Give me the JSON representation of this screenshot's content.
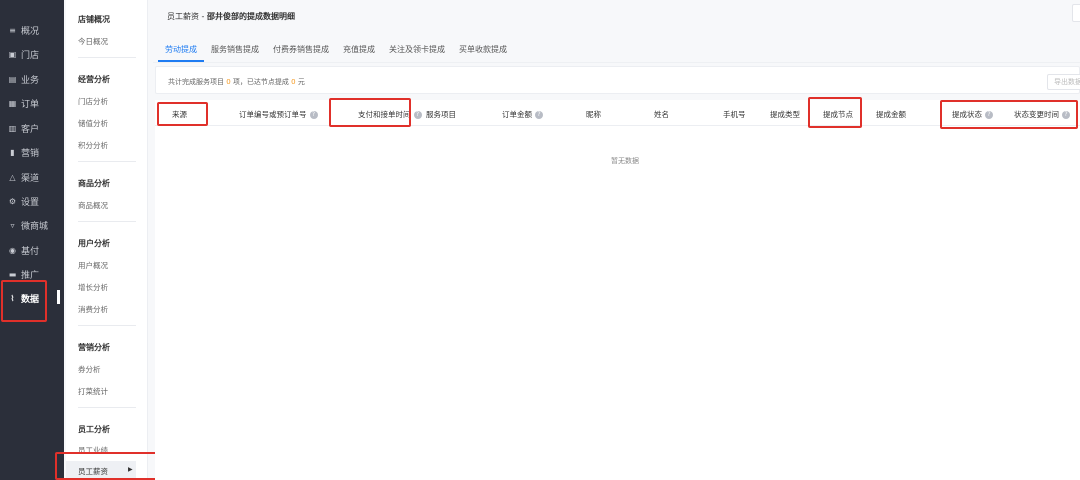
{
  "nav": {
    "items": [
      {
        "icon": "menu-icon",
        "glyph": "≡",
        "label": "概况"
      },
      {
        "icon": "store-icon",
        "glyph": "▣",
        "label": "门店"
      },
      {
        "icon": "briefcase-icon",
        "glyph": "▤",
        "label": "业务"
      },
      {
        "icon": "order-icon",
        "glyph": "▦",
        "label": "订单"
      },
      {
        "icon": "customer-icon",
        "glyph": "▥",
        "label": "客户"
      },
      {
        "icon": "marketing-icon",
        "glyph": "▮",
        "label": "营销"
      },
      {
        "icon": "channel-icon",
        "glyph": "△",
        "label": "渠道"
      },
      {
        "icon": "settings-icon",
        "glyph": "⚙",
        "label": "设置"
      },
      {
        "icon": "micro-mall-icon",
        "glyph": "▿",
        "label": "微商城"
      },
      {
        "icon": "jifu-icon",
        "glyph": "◉",
        "label": "基付"
      },
      {
        "icon": "promote-icon",
        "glyph": "▬",
        "label": "推广"
      },
      {
        "icon": "chart-icon",
        "glyph": "⌇",
        "label": "数据"
      }
    ],
    "active_index": 11
  },
  "submenu": {
    "sections": [
      {
        "title": "店铺概况",
        "items": [
          "今日概况"
        ]
      },
      {
        "title": "经营分析",
        "items": [
          "门店分析",
          "储值分析",
          "积分分析"
        ]
      },
      {
        "title": "商品分析",
        "items": [
          "商品概况"
        ]
      },
      {
        "title": "用户分析",
        "items": [
          "用户概况",
          "增长分析",
          "消费分析"
        ]
      },
      {
        "title": "营销分析",
        "items": [
          "券分析",
          "打菜统计"
        ]
      },
      {
        "title": "员工分析",
        "items": [
          "员工业绩"
        ]
      }
    ],
    "active_item": "员工薪资"
  },
  "page": {
    "title_prefix": "员工薪资 - ",
    "title_main": "邵井俊部的提成数据明细"
  },
  "tabs": [
    "劳动提成",
    "服务销售提成",
    "付费券销售提成",
    "充值提成",
    "关注及领卡提成",
    "买单收款提成"
  ],
  "active_tab": 0,
  "summary": {
    "prefix": "共计完成服务项目 ",
    "count": "0",
    "middle": " 项，已达节点提成 ",
    "amount": "0",
    "suffix": " 元",
    "export_label": "导出数据"
  },
  "table": {
    "columns": [
      {
        "label": "来源",
        "help": false
      },
      {
        "label": "订单编号或预订单号",
        "help": true
      },
      {
        "label": "支付和接单时间",
        "help": true
      },
      {
        "label": "服务项目",
        "help": false
      },
      {
        "label": "订单金额",
        "help": true
      },
      {
        "label": "昵称",
        "help": false
      },
      {
        "label": "姓名",
        "help": false
      },
      {
        "label": "手机号",
        "help": false
      },
      {
        "label": "提成类型",
        "help": false
      },
      {
        "label": "提成节点",
        "help": false
      },
      {
        "label": "提成金额",
        "help": false
      },
      {
        "label": "提成状态",
        "help": true
      },
      {
        "label": "状态变更时间",
        "help": true
      }
    ],
    "empty_text": "暂无数据"
  },
  "colors": {
    "accent": "#1f7cf2",
    "highlight": "#e0302a",
    "nav_bg": "#2b2f3a",
    "number": "#f59a23"
  }
}
